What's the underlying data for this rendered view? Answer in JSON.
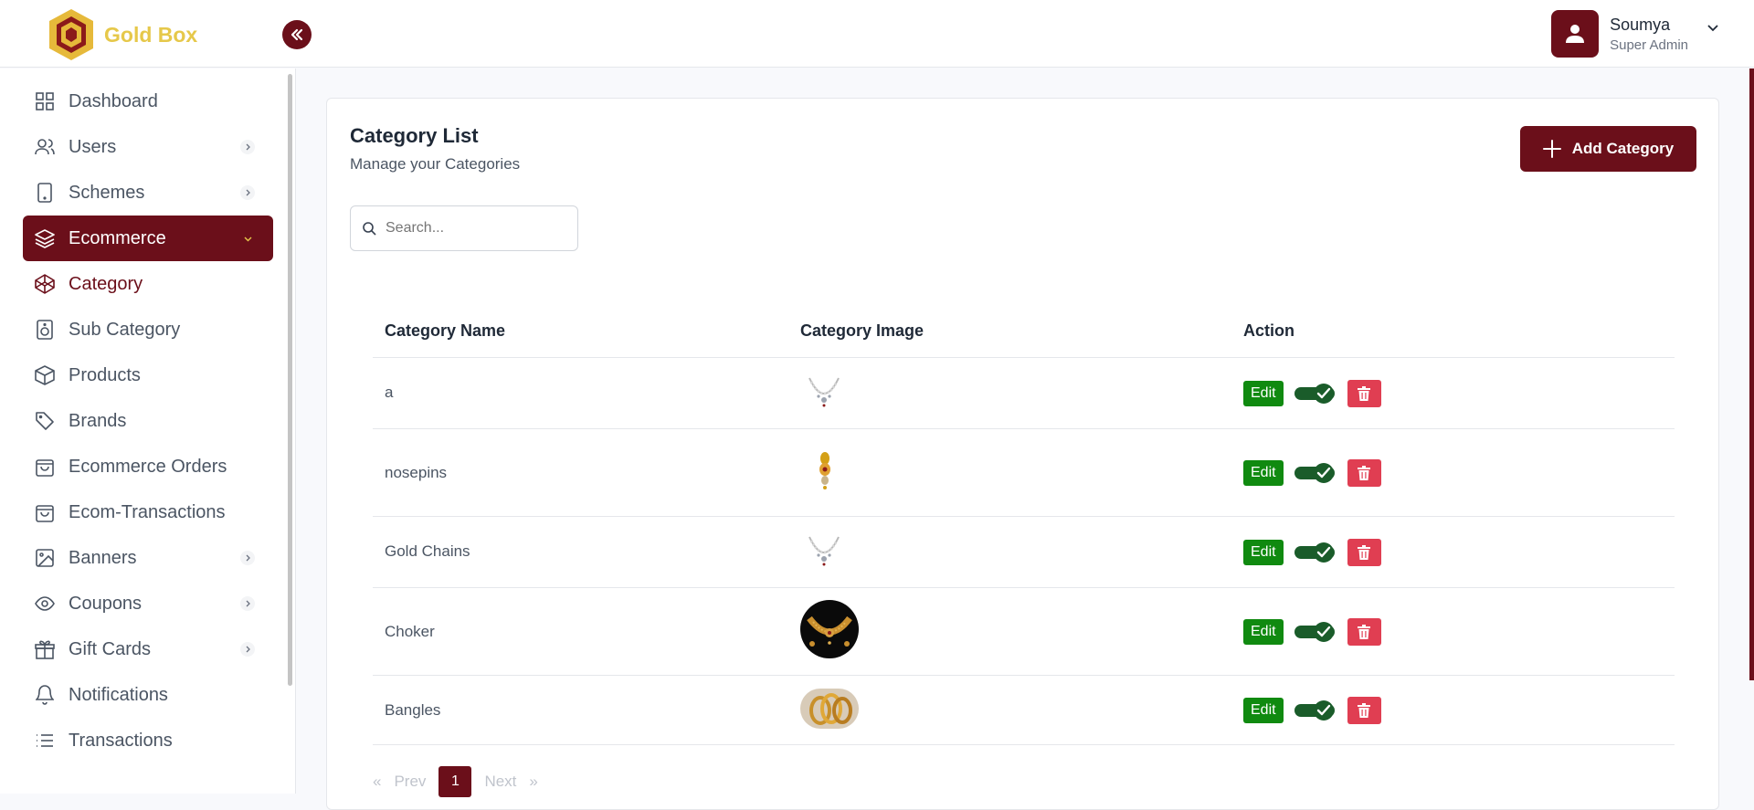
{
  "brand": {
    "name": "Gold Box"
  },
  "user": {
    "name": "Soumya",
    "role": "Super Admin"
  },
  "sidebar": {
    "items": [
      {
        "label": "Dashboard",
        "icon": "grid-icon"
      },
      {
        "label": "Users",
        "icon": "users-icon"
      },
      {
        "label": "Schemes",
        "icon": "tablet-icon"
      },
      {
        "label": "Ecommerce",
        "icon": "layers-icon"
      },
      {
        "label": "Category",
        "icon": "codepen-icon"
      },
      {
        "label": "Sub Category",
        "icon": "speaker-icon"
      },
      {
        "label": "Products",
        "icon": "box-icon"
      },
      {
        "label": "Brands",
        "icon": "tag-icon"
      },
      {
        "label": "Ecommerce Orders",
        "icon": "shopping-bag-icon"
      },
      {
        "label": "Ecom-Transactions",
        "icon": "shopping-bag-icon"
      },
      {
        "label": "Banners",
        "icon": "image-icon"
      },
      {
        "label": "Coupons",
        "icon": "eye-icon"
      },
      {
        "label": "Gift Cards",
        "icon": "gift-icon"
      },
      {
        "label": "Notifications",
        "icon": "bell-icon"
      },
      {
        "label": "Transactions",
        "icon": "list-icon"
      }
    ]
  },
  "page": {
    "title": "Category List",
    "subtitle": "Manage your Categories",
    "add_label": "Add Category",
    "search_placeholder": "Search..."
  },
  "table": {
    "headers": [
      "Category Name",
      "Category Image",
      "Action"
    ],
    "rows": [
      {
        "name": "a",
        "image": "necklace-icon"
      },
      {
        "name": "nosepins",
        "image": "nosepin-icon"
      },
      {
        "name": "Gold Chains",
        "image": "necklace-icon"
      },
      {
        "name": "Choker",
        "image": "choker-photo"
      },
      {
        "name": "Bangles",
        "image": "bangles-photo"
      }
    ],
    "edit_label": "Edit"
  },
  "pagination": {
    "prev": "Prev",
    "next": "Next",
    "current": "1",
    "first_glyph": "«",
    "last_glyph": "»"
  },
  "colors": {
    "brand": "#6b0f1a",
    "edit": "#108a10",
    "delete": "#e03e52",
    "logo": "#e6c84a"
  }
}
